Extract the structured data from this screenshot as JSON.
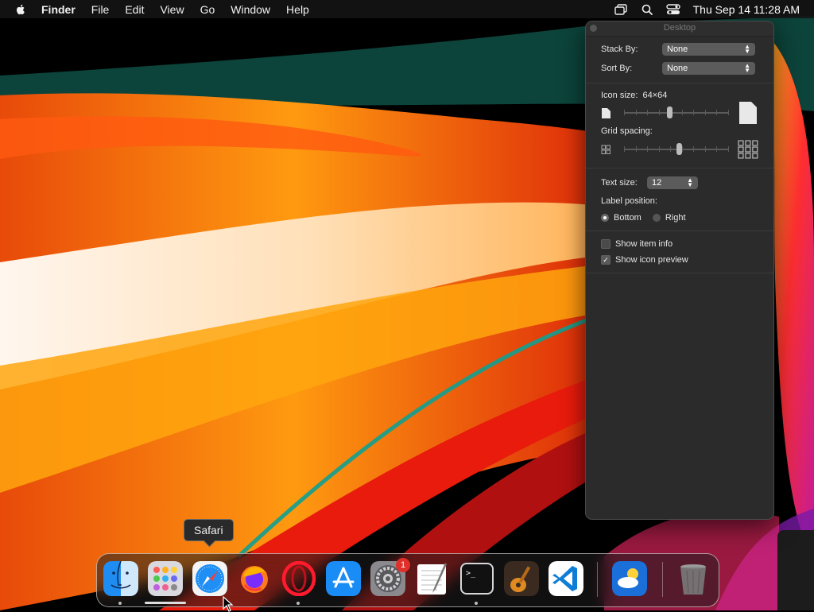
{
  "menubar": {
    "app_name": "Finder",
    "items": [
      "File",
      "Edit",
      "View",
      "Go",
      "Window",
      "Help"
    ],
    "clock": "Thu Sep 14  11:28 AM",
    "icons": [
      "apple-icon",
      "screen-mirroring-icon",
      "spotlight-search-icon",
      "control-center-icon"
    ]
  },
  "panel": {
    "title": "Desktop",
    "stack_by_label": "Stack By:",
    "stack_by_value": "None",
    "sort_by_label": "Sort By:",
    "sort_by_value": "None",
    "icon_size_label": "Icon size:",
    "icon_size_value": "64×64",
    "icon_size_level": 0.43,
    "grid_spacing_label": "Grid spacing:",
    "grid_spacing_level": 0.53,
    "text_size_label": "Text size:",
    "text_size_value": "12",
    "label_position_label": "Label position:",
    "label_position_options": [
      "Bottom",
      "Right"
    ],
    "label_position_selected": "Bottom",
    "show_item_info_label": "Show item info",
    "show_item_info_checked": false,
    "show_icon_preview_label": "Show icon preview",
    "show_icon_preview_checked": true
  },
  "dock": {
    "tooltip": "Safari",
    "apps": [
      "Finder",
      "Launchpad",
      "Safari",
      "Firefox",
      "Opera",
      "App Store",
      "System Preferences",
      "TextEdit",
      "Terminal",
      "GarageBand",
      "Visual Studio Code",
      "Weather",
      "Trash"
    ],
    "system_preferences_badge": "1",
    "running": [
      "Finder",
      "Opera",
      "Terminal"
    ]
  },
  "colors": {
    "menubar_bg": "#141414",
    "panel_bg": "#2b2b2b",
    "badge": "#e0302a",
    "wallpaper_orange": "#ff8a00",
    "wallpaper_red": "#e81b0c"
  }
}
